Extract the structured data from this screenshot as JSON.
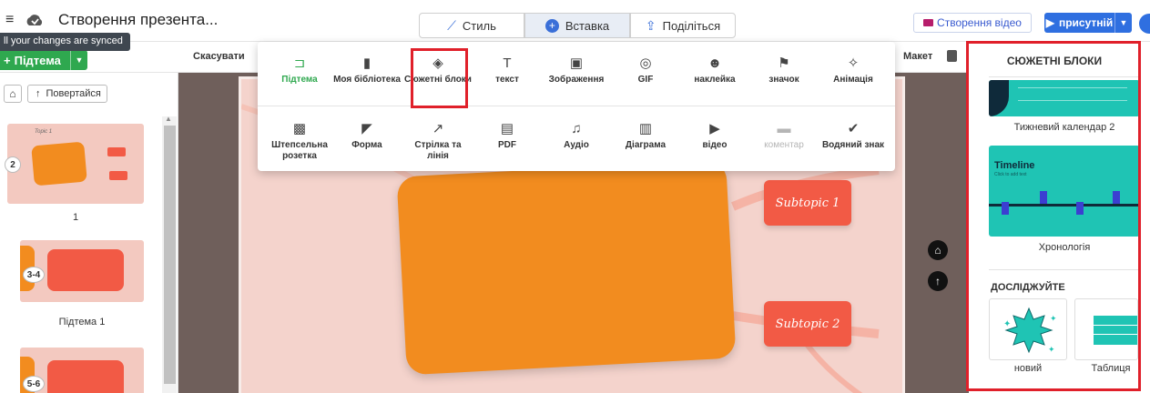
{
  "app": {
    "doc_title": "Створення презента...",
    "sync_tooltip": "ll your changes are synced"
  },
  "top_tabs": {
    "style": "Стиль",
    "insert": "Вставка",
    "share": "Поділіться"
  },
  "top_right": {
    "create_video": "Створення відео",
    "present": "присутній"
  },
  "toolbar": {
    "subtopic_button": "Підтема",
    "undo": "Скасувати",
    "layout": "Макет"
  },
  "left_panel": {
    "back_button": "Повертайся",
    "thumbnails": [
      {
        "number": "2",
        "caption": "1"
      },
      {
        "number": "3-4",
        "caption": "Підтема 1"
      },
      {
        "number": "5-6",
        "caption": ""
      }
    ]
  },
  "insert_menu": {
    "row1": [
      "Підтема",
      "Моя бібліотека",
      "Сюжетні блоки",
      "текст",
      "Зображення",
      "GIF",
      "наклейка",
      "значок",
      "Анімація"
    ],
    "row2": [
      "Штепсельна розетка",
      "Форма",
      "Стрілка та лінія",
      "PDF",
      "Аудіо",
      "Діаграма",
      "відео",
      "коментар",
      "Водяний знак"
    ],
    "active_item": "Підтема",
    "highlighted_item": "Сюжетні блоки",
    "disabled_item": "коментар"
  },
  "slide": {
    "subtopic1": "Subtopic 1",
    "subtopic2": "Subtopic 2",
    "mini_label": "Topic 1"
  },
  "right_panel": {
    "title": "СЮЖЕТНІ БЛОКИ",
    "cards": [
      {
        "caption": "Тижневий календар 2"
      },
      {
        "caption": "Хронологія",
        "inner_title": "Timeline",
        "inner_sub": "Click to add text"
      }
    ],
    "explore_heading": "ДОСЛІДЖУЙТЕ",
    "explore_cards": [
      {
        "caption": "новий"
      },
      {
        "caption": "Таблиця"
      }
    ]
  },
  "colors": {
    "accent_blue": "#2f6fe0",
    "accent_green": "#2fa84f",
    "highlight_red": "#e0202a",
    "slide_orange": "#f28c1f",
    "subtopic_red": "#f25a45",
    "teal": "#1fc4b4"
  }
}
